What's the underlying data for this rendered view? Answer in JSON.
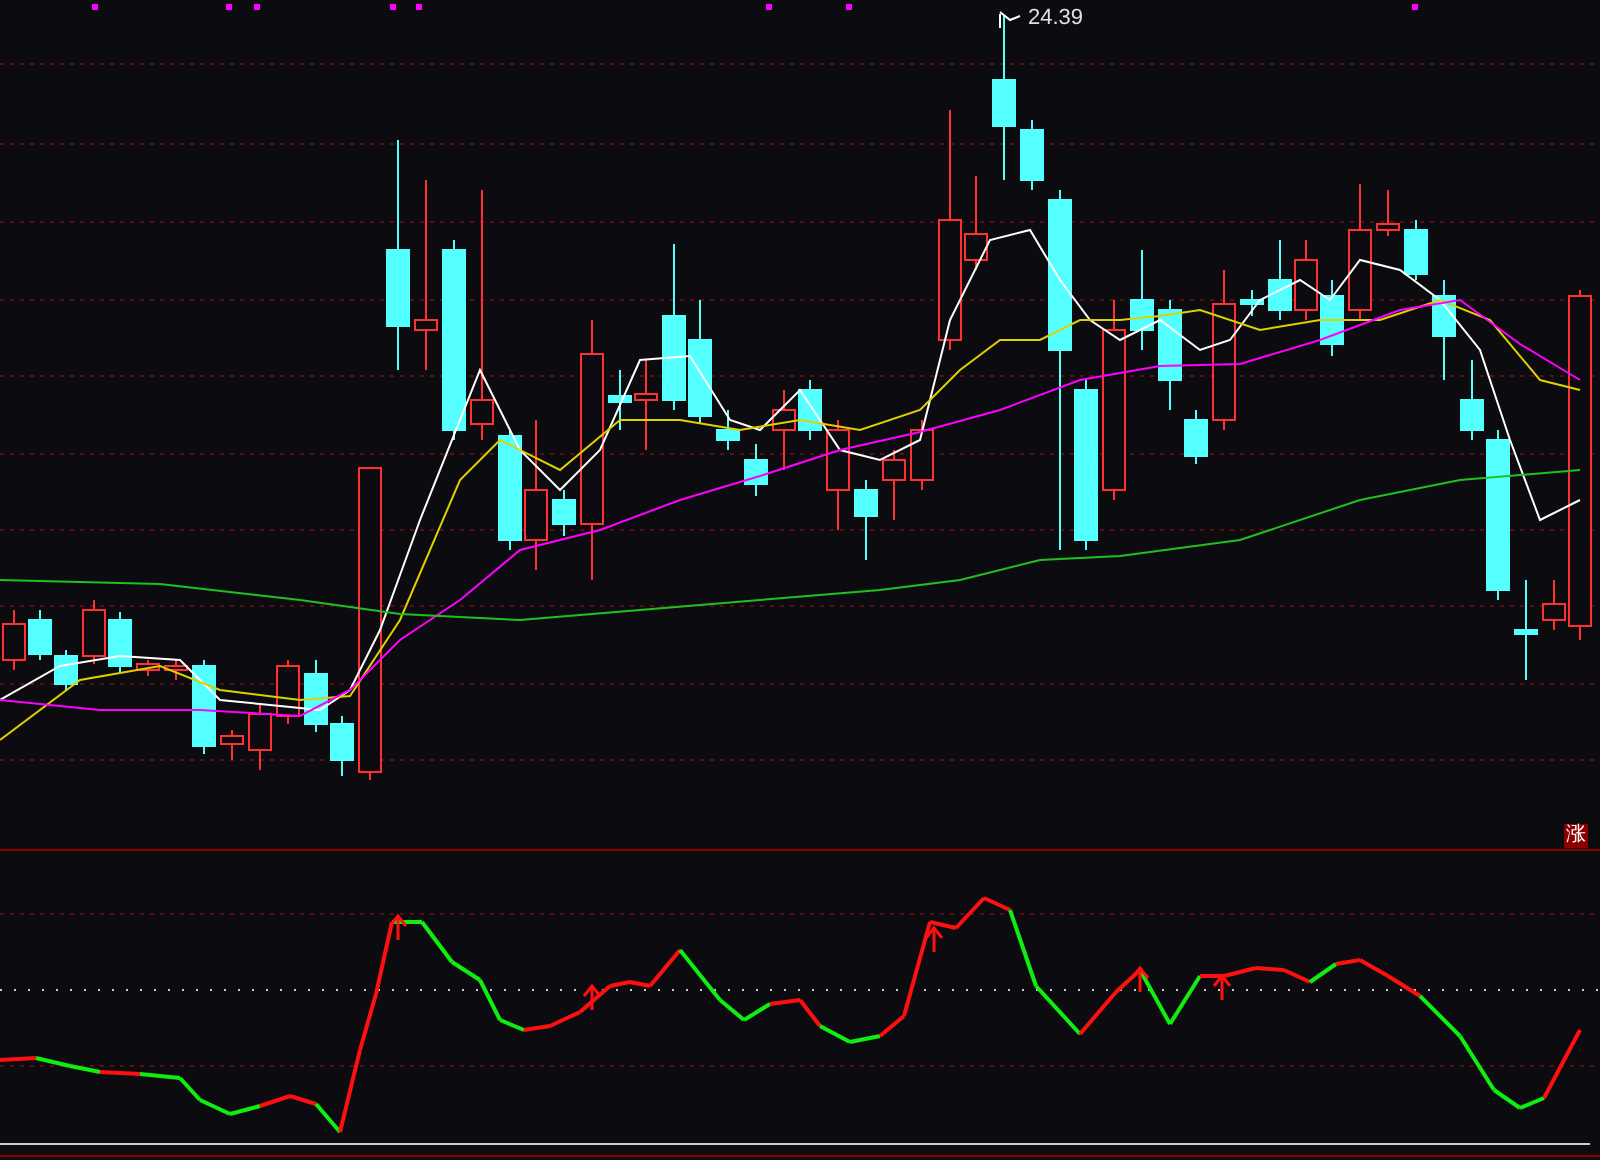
{
  "price_chart": {
    "high_price_label": "24.39",
    "badge": "涨"
  }
}
